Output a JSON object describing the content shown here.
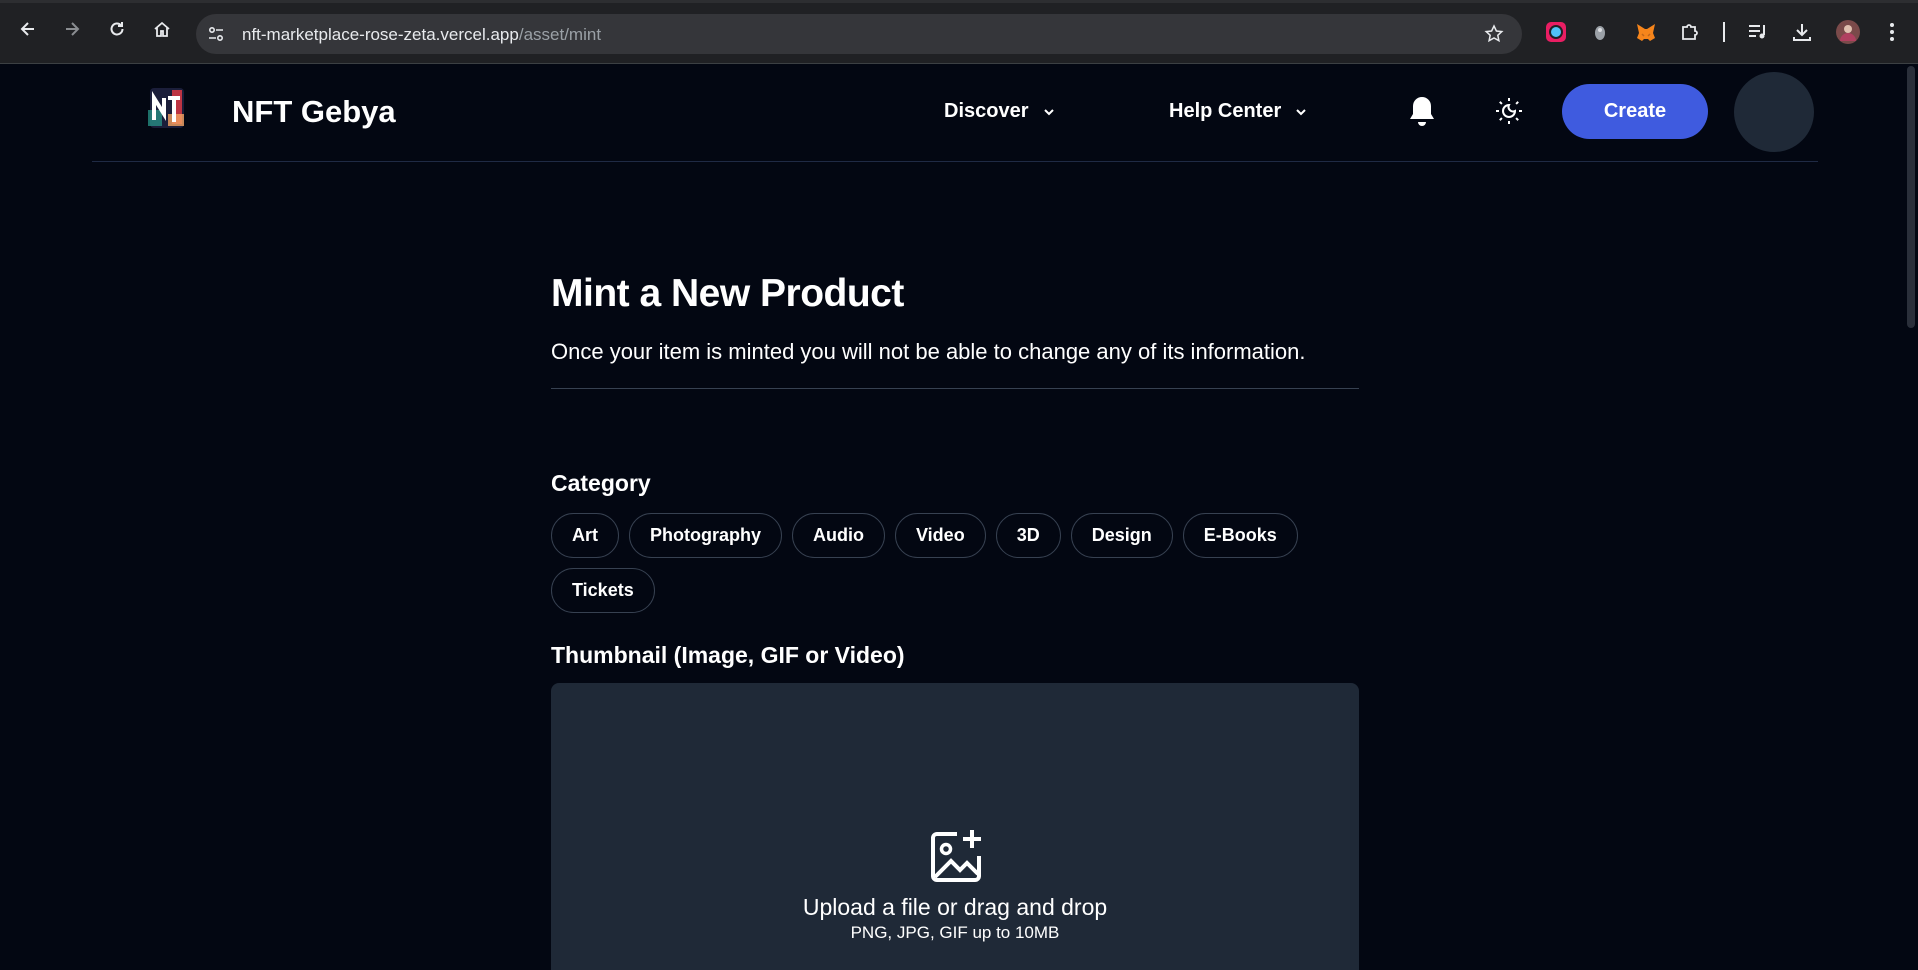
{
  "browser": {
    "url_host": "nft-marketplace-rose-zeta.vercel.app",
    "url_path": "/asset/mint",
    "icons": [
      "back-icon",
      "forward-icon",
      "reload-icon",
      "home-icon",
      "site-settings-icon",
      "bookmark-star-icon",
      "color-extension-icon",
      "ghost-extension-icon",
      "metamask-fox-icon",
      "extensions-puzzle-icon",
      "media-queue-icon",
      "download-icon",
      "profile-avatar-icon",
      "menu-kebab-icon"
    ]
  },
  "header": {
    "brand": "NFT Gebya",
    "nav": [
      {
        "label": "Discover"
      },
      {
        "label": "Help Center"
      }
    ],
    "create_label": "Create"
  },
  "main": {
    "title": "Mint a New Product",
    "subtitle": "Once your item is minted you will not be able to change any of its information.",
    "category_label": "Category",
    "categories": [
      "Art",
      "Photography",
      "Audio",
      "Video",
      "3D",
      "Design",
      "E-Books",
      "Tickets"
    ],
    "thumbnail_label": "Thumbnail (Image, GIF or Video)",
    "upload_text": "Upload a file or drag and drop",
    "upload_hint": "PNG, JPG, GIF up to 10MB"
  },
  "colors": {
    "background": "#030712",
    "accent": "#3f5bdf",
    "dropzone": "#1f2937"
  }
}
